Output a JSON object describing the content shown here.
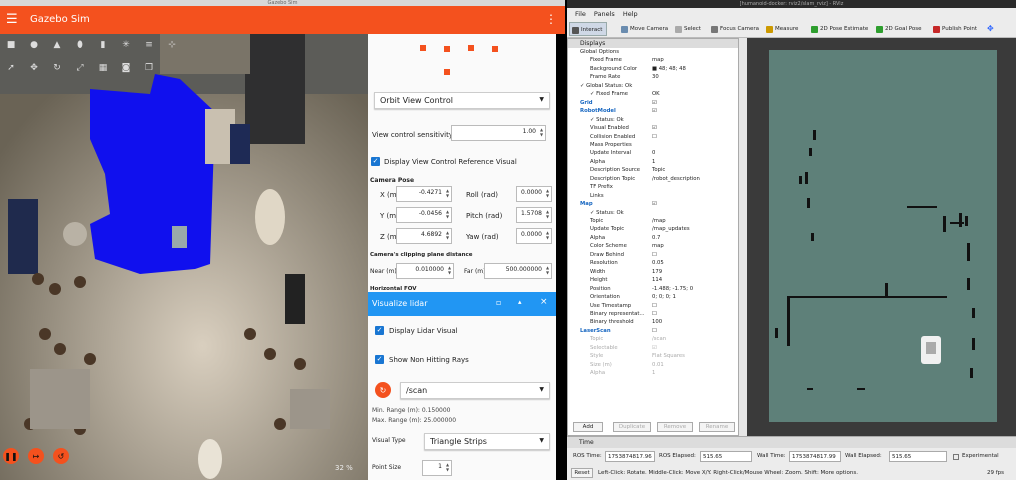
{
  "gazebo": {
    "window_title": "Gazebo Sim",
    "app_title": "Gazebo Sim",
    "orbit": {
      "control_select": "Orbit View Control",
      "sensitivity_label": "View control sensitivity",
      "sensitivity_value": "1.00",
      "display_ref_label": "Display View Control Reference Visual",
      "camera_pose_label": "Camera Pose",
      "x_label": "X (m)",
      "x_value": "-0.4271",
      "y_label": "Y (m)",
      "y_value": "-0.0456",
      "z_label": "Z (m)",
      "z_value": "4.6892",
      "roll_label": "Roll (rad)",
      "roll_value": "0.0000",
      "pitch_label": "Pitch (rad)",
      "pitch_value": "1.5708",
      "yaw_label": "Yaw (rad)",
      "yaw_value": "0.0000",
      "clip_label": "Camera's clipping plane distance",
      "near_label": "Near (m)",
      "near_value": "0.010000",
      "far_label": "Far (m)",
      "far_value": "500.000000",
      "fov_label": "Horizontal FOV"
    },
    "lidar": {
      "title": "Visualize lidar",
      "display_label": "Display Lidar Visual",
      "nonhit_label": "Show Non Hitting Rays",
      "topic": "/scan",
      "min_range": "Min. Range (m):  0.150000",
      "max_range": "Max. Range (m):  25.000000",
      "visual_type_label": "Visual Type",
      "visual_type_value": "Triangle Strips",
      "point_size_label": "Point Size",
      "point_size_value": "1"
    },
    "zoom_text": "32 %"
  },
  "rviz": {
    "window_title": "[humanoid-docker: rviz2/slam_rviz] - RViz",
    "menu": [
      "File",
      "Panels",
      "Help"
    ],
    "tools": [
      {
        "label": "Interact",
        "icon": "interact-icon",
        "color": "#555555"
      },
      {
        "label": "Move Camera",
        "icon": "move-camera-icon",
        "color": "#6a8caf"
      },
      {
        "label": "Select",
        "icon": "select-icon",
        "color": "#aaaaaa"
      },
      {
        "label": "Focus Camera",
        "icon": "focus-camera-icon",
        "color": "#777777"
      },
      {
        "label": "Measure",
        "icon": "measure-icon",
        "color": "#cc9900"
      },
      {
        "label": "2D Pose Estimate",
        "icon": "pose-estimate-icon",
        "color": "#2e9e2e"
      },
      {
        "label": "2D Goal Pose",
        "icon": "goal-pose-icon",
        "color": "#2e9e2e"
      },
      {
        "label": "Publish Point",
        "icon": "publish-point-icon",
        "color": "#c62828"
      }
    ],
    "displays_title": "Displays",
    "displays_rows": [
      {
        "k": "Global Options",
        "v": "",
        "ind": 1,
        "cls": ""
      },
      {
        "k": "Fixed Frame",
        "v": "map",
        "ind": 2,
        "cls": ""
      },
      {
        "k": "Background Color",
        "v": "■ 48; 48; 48",
        "ind": 2,
        "cls": ""
      },
      {
        "k": "Frame Rate",
        "v": "30",
        "ind": 2,
        "cls": ""
      },
      {
        "k": "✓ Global Status: Ok",
        "v": "",
        "ind": 1,
        "cls": ""
      },
      {
        "k": "✓ Fixed Frame",
        "v": "OK",
        "ind": 2,
        "cls": ""
      },
      {
        "k": "Grid",
        "v": "☑",
        "ind": 1,
        "cls": "blue"
      },
      {
        "k": "RobotModel",
        "v": "☑",
        "ind": 1,
        "cls": "blue"
      },
      {
        "k": "✓ Status: Ok",
        "v": "",
        "ind": 2,
        "cls": ""
      },
      {
        "k": "Visual Enabled",
        "v": "☑",
        "ind": 2,
        "cls": ""
      },
      {
        "k": "Collision Enabled",
        "v": "☐",
        "ind": 2,
        "cls": ""
      },
      {
        "k": "Mass Properties",
        "v": "",
        "ind": 2,
        "cls": ""
      },
      {
        "k": "Update Interval",
        "v": "0",
        "ind": 2,
        "cls": ""
      },
      {
        "k": "Alpha",
        "v": "1",
        "ind": 2,
        "cls": ""
      },
      {
        "k": "Description Source",
        "v": "Topic",
        "ind": 2,
        "cls": ""
      },
      {
        "k": "Description Topic",
        "v": "/robot_description",
        "ind": 2,
        "cls": ""
      },
      {
        "k": "TF Prefix",
        "v": "",
        "ind": 2,
        "cls": ""
      },
      {
        "k": "Links",
        "v": "",
        "ind": 2,
        "cls": ""
      },
      {
        "k": "Map",
        "v": "☑",
        "ind": 1,
        "cls": "blue"
      },
      {
        "k": "✓ Status: Ok",
        "v": "",
        "ind": 2,
        "cls": ""
      },
      {
        "k": "Topic",
        "v": "/map",
        "ind": 2,
        "cls": ""
      },
      {
        "k": "Update Topic",
        "v": "/map_updates",
        "ind": 2,
        "cls": ""
      },
      {
        "k": "Alpha",
        "v": "0.7",
        "ind": 2,
        "cls": ""
      },
      {
        "k": "Color Scheme",
        "v": "map",
        "ind": 2,
        "cls": ""
      },
      {
        "k": "Draw Behind",
        "v": "☐",
        "ind": 2,
        "cls": ""
      },
      {
        "k": "Resolution",
        "v": "0.05",
        "ind": 2,
        "cls": ""
      },
      {
        "k": "Width",
        "v": "179",
        "ind": 2,
        "cls": ""
      },
      {
        "k": "Height",
        "v": "114",
        "ind": 2,
        "cls": ""
      },
      {
        "k": "Position",
        "v": "-1.488; -1.75; 0",
        "ind": 2,
        "cls": ""
      },
      {
        "k": "Orientation",
        "v": "0; 0; 0; 1",
        "ind": 2,
        "cls": ""
      },
      {
        "k": "Use Timestamp",
        "v": "☐",
        "ind": 2,
        "cls": ""
      },
      {
        "k": "Binary representat...",
        "v": "☐",
        "ind": 2,
        "cls": ""
      },
      {
        "k": "Binary threshold",
        "v": "100",
        "ind": 2,
        "cls": ""
      },
      {
        "k": "LaserScan",
        "v": "☐",
        "ind": 1,
        "cls": "blue"
      },
      {
        "k": "Topic",
        "v": "/scan",
        "ind": 2,
        "cls": "grey"
      },
      {
        "k": "Selectable",
        "v": "☑",
        "ind": 2,
        "cls": "grey"
      },
      {
        "k": "Style",
        "v": "Flat Squares",
        "ind": 2,
        "cls": "grey"
      },
      {
        "k": "Size (m)",
        "v": "0.01",
        "ind": 2,
        "cls": "grey"
      },
      {
        "k": "Alpha",
        "v": "1",
        "ind": 2,
        "cls": "grey"
      }
    ],
    "buttons": {
      "add": "Add",
      "duplicate": "Duplicate",
      "remove": "Remove",
      "rename": "Rename"
    },
    "time": {
      "title": "Time",
      "ros_time_label": "ROS Time:",
      "ros_time": "1753874817.96",
      "ros_elapsed_label": "ROS Elapsed:",
      "ros_elapsed": "515.65",
      "wall_time_label": "Wall Time:",
      "wall_time": "1753874817.99",
      "wall_elapsed_label": "Wall Elapsed:",
      "wall_elapsed": "515.65",
      "experimental": "Experimental"
    },
    "status": {
      "reset": "Reset",
      "hint": "Left-Click: Rotate. Middle-Click: Move X/Y. Right-Click/Mouse Wheel: Zoom. Shift: More options.",
      "fps": "29 fps"
    }
  }
}
